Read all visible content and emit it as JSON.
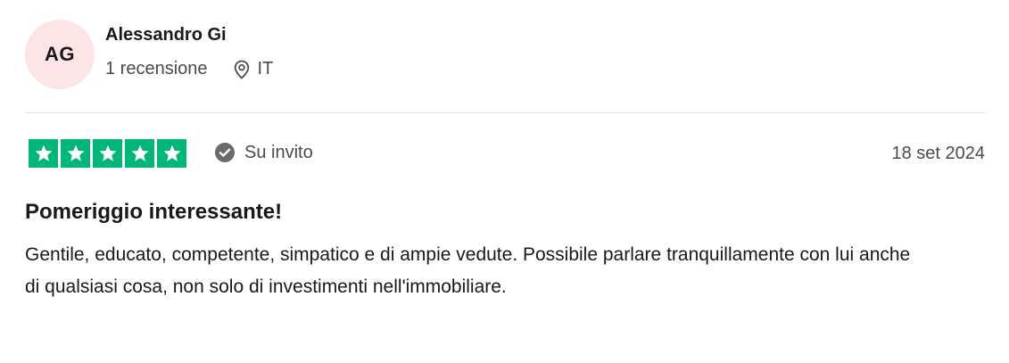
{
  "reviewer": {
    "initials": "AG",
    "name": "Alessandro Gi",
    "review_count": "1 recensione",
    "country": "IT",
    "avatar_color": "#fde4e7"
  },
  "review": {
    "rating": 5,
    "rating_max": 5,
    "star_color": "#00b67a",
    "invite_label": "Su invito",
    "date": "18 set 2024",
    "title": "Pomeriggio interessante!",
    "text": "Gentile, educato, competente, simpatico e di ampie vedute. Possibile parlare tranquillamente con lui anche di qualsiasi cosa, non solo di investimenti nell'immobiliare."
  },
  "icons": {
    "location": "location-pin-icon",
    "verified": "check-circle-icon",
    "star": "star-icon"
  }
}
